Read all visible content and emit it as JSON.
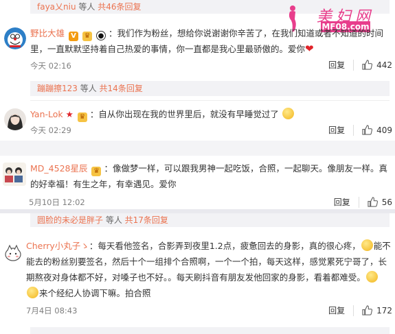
{
  "watermark": {
    "site_name": "美妇网",
    "domain": "MF08.com"
  },
  "thread1": {
    "top_reply": {
      "users": "faya乂niu",
      "suffix": " 等人 ",
      "count": "共46条回复"
    },
    "comment": {
      "username": "野比大雄",
      "text": "：我们作为粉丝，想给你说谢谢你辛苦了，在我们知道或者不知道的时间里，一直默默坚持着自己热爱的事情，你一直都是我心里最骄傲的。爱你",
      "time": "今天 02:16",
      "reply_label": "回复",
      "likes": "442"
    },
    "reply_summary": {
      "users": "蹦蹦擦123",
      "suffix": " 等人 ",
      "count": "共14条回复"
    }
  },
  "thread2": {
    "comment": {
      "username": "Yan-Lok",
      "text": "：自从你出现在我的世界里后，就没有早睡觉过了",
      "time": "今天 02:29",
      "reply_label": "回复",
      "likes": "409"
    }
  },
  "thread3": {
    "comment": {
      "username": "MD_4528星辰",
      "text": "：像做梦一样，可以跟我男神一起吃饭，合照，一起聊天。像朋友一样。真的好幸福！有生之年，有幸遇见。爱你",
      "time": "5月10日 12:02",
      "reply_label": "回复",
      "likes": "56"
    }
  },
  "thread4": {
    "top_reply": {
      "users": "圆脸的未必是胖子",
      "suffix": " 等人 ",
      "count": "共17条回复"
    },
    "comment": {
      "username": "Cherry小丸子ゝ",
      "text_1": "：每天看他签名，合影弄到夜里1.2点，疲惫回去的身影，真的很心疼，",
      "text_2": "能不能去的粉丝别要签名，然后十个一组排个合照啊，一个一个拍，每天这样，感觉累死宁哥了，长期熬夜对身体都不好，对嗓子也不好。。每天刷抖音有朋友发他回家的身影，看着都难受。",
      "text_3": "来个经纪人协调下嘛。拍合照",
      "time": "7月4日 08:43",
      "reply_label": "回复",
      "likes": "172"
    }
  },
  "colors": {
    "accent": "#eb7350",
    "link": "#eb7350",
    "watermark": "#e83e8c"
  },
  "icons": [
    "thumbs-up-icon",
    "vip-badge-icon",
    "heart-emoji-icon",
    "laughing-emoji-icon",
    "sad-emoji-icon"
  ]
}
